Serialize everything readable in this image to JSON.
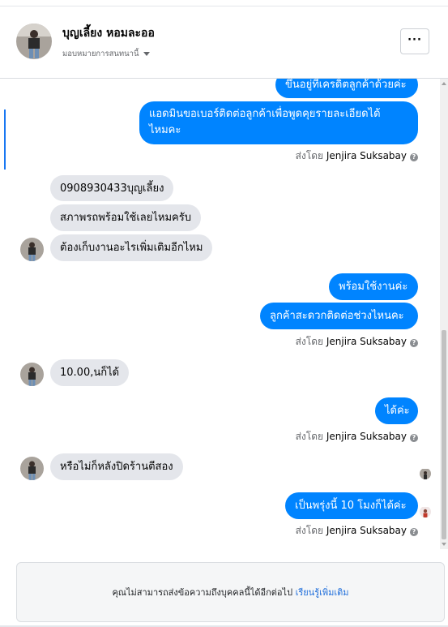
{
  "header": {
    "name": "บุญเลี้ยง หอมละออ",
    "assign_label": "มอบหมายการสนทนานี้",
    "more_label": "···"
  },
  "messages": {
    "m1": "ขึ้นอยู่ที่เครดิตลูกค้าด้วยค่ะ",
    "m2_line1": "แอดมินขอเบอร์ติดต่อลูกค้าเพื่อพูดคุยรายละเอียดได้",
    "m2_line2": "ไหมคะ",
    "m3": "0908930433บุญเลี้ยง",
    "m4": "สภาพรถพร้อมใช้เลยไหมครับ",
    "m5": "ต้องเก็บงานอะไรเพิ่มเติมอีกไหม",
    "m6": "พร้อมใช้งานค่ะ",
    "m7": "ลูกค้าสะดวกติดต่อช่วงไหนคะ",
    "m8": "10.00,นก็ได้",
    "m9": "ได้ค่ะ",
    "m10": "หรือไม่ก็หลังปิดร้านตีสอง",
    "m11": "เป็นพรุ่งนี้ 10 โมงก็ได้ค่ะ"
  },
  "sent_by": {
    "prefix": "ส่งโดย",
    "agent": "Jenjira Suksabay",
    "help_icon": "?"
  },
  "footer": {
    "text": "คุณไม่สามารถส่งข้อความถึงบุคคลนี้ได้อีกต่อไป",
    "link": "เรียนรู้เพิ่มเติม"
  },
  "colors": {
    "outgoing_bubble": "#0084ff",
    "incoming_bubble": "#e4e6eb",
    "link": "#216fdb"
  }
}
